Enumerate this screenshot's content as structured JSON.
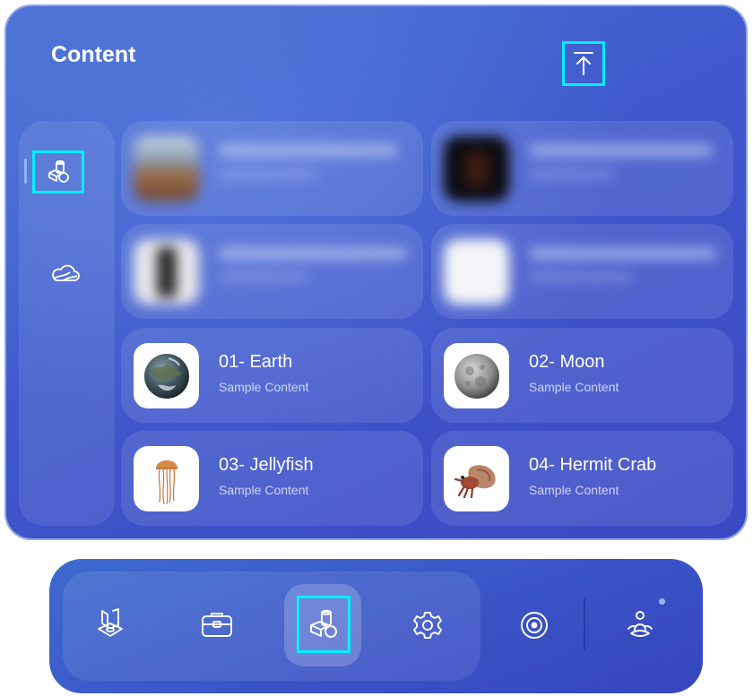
{
  "panel": {
    "title": "Content"
  },
  "icons": {
    "upload": "upload-icon",
    "objects": "objects-icon",
    "cloud": "cloud-icon"
  },
  "cards": [
    {
      "title": "",
      "subtitle": "",
      "blurred": true,
      "thumb": "blurred-photo"
    },
    {
      "title": "",
      "subtitle": "",
      "blurred": true,
      "thumb": "blurred-dark"
    },
    {
      "title": "",
      "subtitle": "",
      "blurred": true,
      "thumb": "blurred-object"
    },
    {
      "title": "",
      "subtitle": "",
      "blurred": true,
      "thumb": "blurred-white"
    },
    {
      "title": "01- Earth",
      "subtitle": "Sample Content",
      "blurred": false,
      "thumb": "earth"
    },
    {
      "title": "02- Moon",
      "subtitle": "Sample Content",
      "blurred": false,
      "thumb": "moon"
    },
    {
      "title": "03- Jellyfish",
      "subtitle": "Sample Content",
      "blurred": false,
      "thumb": "jellyfish"
    },
    {
      "title": "04- Hermit Crab",
      "subtitle": "Sample Content",
      "blurred": false,
      "thumb": "hermit-crab"
    }
  ],
  "dock": {
    "items": [
      {
        "name": "spaces-icon",
        "active": false
      },
      {
        "name": "toolbox-icon",
        "active": false
      },
      {
        "name": "objects-icon",
        "active": true
      },
      {
        "name": "settings-gear-icon",
        "active": false
      },
      {
        "name": "target-icon",
        "active": false
      },
      {
        "name": "person-meditate-icon",
        "active": false,
        "badge": true
      }
    ]
  },
  "colors": {
    "accent_focus": "#00f0ff",
    "panel_blue": "#3f59cc"
  }
}
